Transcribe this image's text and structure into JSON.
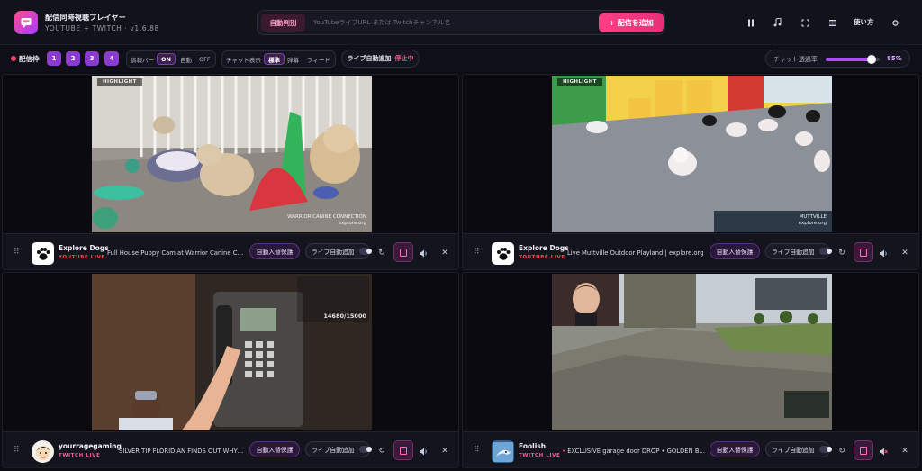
{
  "header": {
    "title": "配信同時視聴プレイヤー",
    "subtitle": "YOUTUBE + TWITCH · v1.6.88",
    "auto_detect_label": "自動判別",
    "search_placeholder": "YouTubeライブURL または Twitchチャンネル名",
    "add_stream_label": "+ 配信を追加",
    "help_label": "使い方",
    "icons": [
      "pause-icon",
      "music-note-icon",
      "fullscreen-icon",
      "layout-grid-icon",
      "gear-icon"
    ]
  },
  "toolbar": {
    "stream_slots_label": "配信枠",
    "slots": [
      "1",
      "2",
      "3",
      "4"
    ],
    "info_bar": {
      "label": "情報バー",
      "options": [
        "ON",
        "自動",
        "OFF"
      ],
      "selected": "ON"
    },
    "chat_display": {
      "label": "チャット表示",
      "options": [
        "標準",
        "弾幕",
        "フィード"
      ],
      "selected": "標準"
    },
    "live_auto_add": {
      "label": "ライブ自動追加",
      "status": "停止中"
    },
    "chat_opacity": {
      "label": "チャット透過率",
      "value_text": "85%",
      "value": 0.85
    }
  },
  "panels": [
    {
      "video_label": "HIGHLIGHT",
      "watermark": "WARRIOR CANINE CONNECTION\nexplore.org",
      "channel": "Explore Dogs",
      "platform": "YOUTUBE LIVE",
      "title": "Full House Puppy Cam at Warrior Canine Con...",
      "fallback_label": "自動入替保護",
      "auto_add_label": "ライブ自動追加"
    },
    {
      "video_label": "HIGHLIGHT",
      "watermark": "MUTTVILLE\nexplore.org",
      "channel": "Explore Dogs",
      "platform": "YOUTUBE LIVE",
      "title": "Live Muttville Outdoor Playland | explore.org",
      "fallback_label": "自動入替保護",
      "auto_add_label": "ライブ自動追加"
    },
    {
      "video_label": "",
      "watermark": "",
      "overlay_counter": "14680/15000",
      "channel": "yourragegaming",
      "platform": "TWITCH LIVE",
      "title": "SILVER TIP FLORIDIAN FINDS OUT WHY T...",
      "fallback_label": "自動入替保護",
      "auto_add_label": "ライブ自動追加"
    },
    {
      "video_label": "",
      "watermark": "",
      "channel": "Foolish",
      "platform": "TWITCH LIVE",
      "title_prefix": "•",
      "title": "EXCLUSIVE garage door DROP • GOLDEN B...",
      "fallback_label": "自動入替保護",
      "auto_add_label": "ライブ自動追加"
    }
  ],
  "colors": {
    "accent_pink": "#ff3f83",
    "accent_purple": "#8b3bd0",
    "youtube_red": "#ff4b4b",
    "twitch_pink": "#ff5a9a"
  }
}
